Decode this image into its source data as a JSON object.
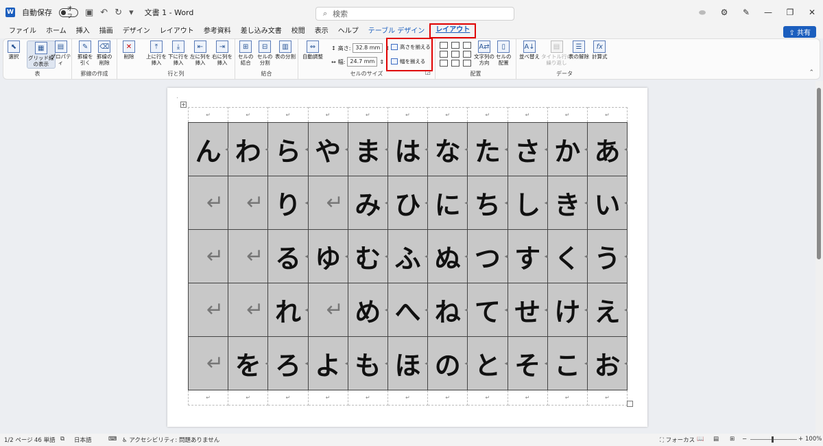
{
  "title_bar": {
    "autosave_label": "自動保存",
    "autosave_state": "オフ",
    "doc_title": "文書 1  -  Word",
    "search_placeholder": "検索"
  },
  "tabs": [
    "ファイル",
    "ホーム",
    "挿入",
    "描画",
    "デザイン",
    "レイアウト",
    "参考資料",
    "差し込み文書",
    "校閲",
    "表示",
    "ヘルプ",
    "テーブル デザイン",
    "レイアウト"
  ],
  "share_label": "共有",
  "ribbon": {
    "select": "選択",
    "gridlines": "グリッド線\nの表示",
    "properties": "プロパティ",
    "draw_table": "罫線を\n引く",
    "eraser": "罫線の\n削除",
    "delete": "削除",
    "insert_above": "上に行を\n挿入",
    "insert_below": "下に行を\n挿入",
    "insert_left": "左に列を\n挿入",
    "insert_right": "右に列を\n挿入",
    "merge_cells": "セルの\n結合",
    "split_cells": "セルの\n分割",
    "split_table": "表の分割",
    "autofit": "自動調整",
    "height_label": "高さ:",
    "height_value": "32.8 mm",
    "width_label": "幅:",
    "width_value": "24.7 mm",
    "distribute_rows": "高さを揃える",
    "distribute_cols": "幅を揃える",
    "text_direction": "文字列の\n方向",
    "cell_margins": "セルの\n配置",
    "sort": "並べ替え",
    "repeat_header": "タイトル行の\n繰り返し",
    "convert_text": "表の解除",
    "formula": "計算式",
    "groups": {
      "table": "表",
      "draw": "罫線の作成",
      "rows_cols": "行と列",
      "merge": "結合",
      "cell_size": "セルのサイズ",
      "alignment": "配置",
      "data": "データ"
    }
  },
  "table": {
    "rows": [
      [
        "ん",
        "わ",
        "ら",
        "や",
        "ま",
        "は",
        "な",
        "た",
        "さ",
        "か",
        "あ"
      ],
      [
        "",
        "",
        "り",
        "",
        "み",
        "ひ",
        "に",
        "ち",
        "し",
        "き",
        "い"
      ],
      [
        "",
        "",
        "る",
        "ゆ",
        "む",
        "ふ",
        "ぬ",
        "つ",
        "す",
        "く",
        "う"
      ],
      [
        "",
        "",
        "れ",
        "",
        "め",
        "へ",
        "ね",
        "て",
        "せ",
        "け",
        "え"
      ],
      [
        "",
        "を",
        "ろ",
        "よ",
        "も",
        "ほ",
        "の",
        "と",
        "そ",
        "こ",
        "お"
      ]
    ],
    "para_mark": "↵",
    "empty_mark": "↵"
  },
  "status": {
    "page": "1/2 ページ",
    "words": "46 単語",
    "language": "日本語",
    "accessibility": "アクセシビリティ: 問題ありません",
    "focus": "フォーカス",
    "zoom": "100%"
  }
}
